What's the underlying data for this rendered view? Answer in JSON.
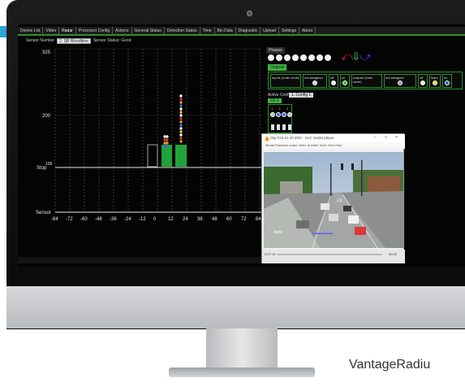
{
  "menu": [
    "Device List",
    "Video",
    "Radar",
    "Processor Config",
    "Actions",
    "General Status",
    "Detection Status",
    "Time",
    "Bin Data",
    "Diagnostic",
    "Upload",
    "Settings",
    "About"
  ],
  "sensor": {
    "number_label": "Sensor Number",
    "number_value": "2. SB Woodbine",
    "status_label": "Sensor Status: Good"
  },
  "plot": {
    "y_labels": [
      "325",
      "200",
      "Stop",
      "Sensor"
    ],
    "stop_tick": "100",
    "x_ticks": [
      "-84",
      "-72",
      "-60",
      "-48",
      "-36",
      "-24",
      "-12",
      "0",
      "12",
      "24",
      "36",
      "48",
      "60",
      "72",
      "84"
    ]
  },
  "phases": {
    "title": "Phases",
    "selected": "Original",
    "inputs_label": "inputs\n(outer circle)",
    "not_assigned_1": "not assigned",
    "off_1": "off",
    "on_1": "on",
    "outputs_label": "outputs\n(inner circle)",
    "not_assigned_2": "not assigned",
    "off_2": "off",
    "learn": "learn",
    "on_2": "on"
  },
  "config": {
    "label": "Active Config",
    "name": "1. Config 1",
    "tab": "Ch 1",
    "numbers": "1 2 3 4"
  },
  "vlc": {
    "title": "rtsp://10.21.10.202/ - VLC media player",
    "menu": "Media   Playback   Audio   Video   Subtitle   Tools   View   Help",
    "stamp": "Iteris",
    "time_start": "0:27:13",
    "time_end": "00:00",
    "progress": 0
  },
  "brand": "VantageRadiu",
  "colors": {
    "grid_green": "#1fa13a",
    "accent_green": "#3fb43f",
    "arrow_red": "#d8262b",
    "arrow_green": "#27b24a",
    "arrow_blue": "#2f4fd6",
    "bg_band": "#2aa6d8"
  }
}
